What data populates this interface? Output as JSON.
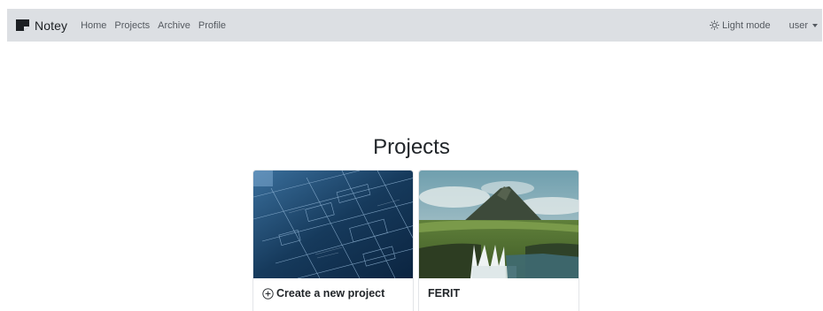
{
  "navbar": {
    "brand": "Notey",
    "links": [
      "Home",
      "Projects",
      "Archive",
      "Profile"
    ],
    "theme_toggle": "Light mode",
    "user_menu": "user"
  },
  "main": {
    "title": "Projects",
    "cards": [
      {
        "label": "Create a new project",
        "icon": "plus-circle-icon"
      },
      {
        "label": "FERIT"
      }
    ]
  },
  "colors": {
    "navbar_bg": "#dcdfe3",
    "text": "#212529",
    "nav_link": "#555a60"
  }
}
